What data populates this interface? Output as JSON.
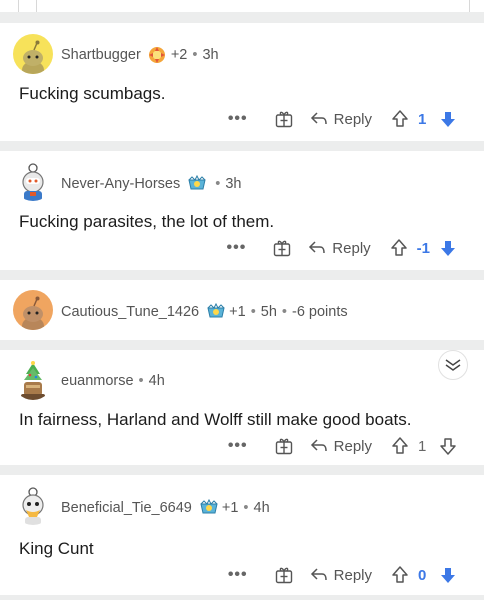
{
  "comments": [
    {
      "username": "Shartbugger",
      "score_suffix": "+2",
      "time": "3h",
      "text": "Fucking scumbags.",
      "votes": "1",
      "vote_state": "downvoted"
    },
    {
      "username": "Never-Any-Horses",
      "time": "3h",
      "text": "Fucking parasites, the lot of them.",
      "votes": "-1",
      "vote_state": "downvoted"
    },
    {
      "username": "Cautious_Tune_1426",
      "score_suffix": "+1",
      "time": "5h",
      "points": "-6 points",
      "collapsed": true
    },
    {
      "username": "euanmorse",
      "time": "4h",
      "text": "In fairness, Harland and Wolff still make good boats.",
      "votes": "1",
      "vote_state": "none"
    },
    {
      "username": "Beneficial_Tie_6649",
      "score_suffix": "+1",
      "time": "4h",
      "text": "King Cunt",
      "votes": "0",
      "vote_state": "downvoted"
    }
  ],
  "labels": {
    "reply": "Reply",
    "more": "•••",
    "dot": "•"
  },
  "colors": {
    "upvote_blue": "#3c78e6",
    "background": "#eceded"
  },
  "icons": [
    "more-icon",
    "gift-icon",
    "reply-icon",
    "upvote-icon",
    "downvote-icon",
    "award-icon",
    "collapse-chevron-icon"
  ]
}
